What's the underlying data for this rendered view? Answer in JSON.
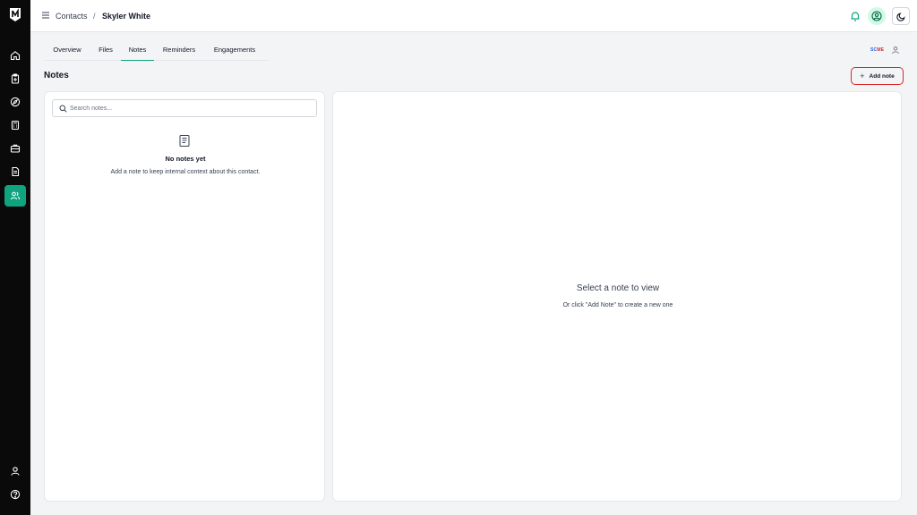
{
  "header": {
    "breadcrumb": [
      "Contacts",
      "/",
      "Skyler White"
    ]
  },
  "tabs": [
    {
      "label": "Overview",
      "active": false
    },
    {
      "label": "Files",
      "active": false
    },
    {
      "label": "Notes",
      "active": true
    },
    {
      "label": "Reminders",
      "active": false
    },
    {
      "label": "Engagements",
      "active": false
    }
  ],
  "brand_badge": {
    "part1": "SC",
    "part2": "ME"
  },
  "notes": {
    "title": "Notes",
    "add_button_label": "Add note",
    "search_placeholder": "Search notes...",
    "empty_title": "No notes yet",
    "empty_description": "Add a note to keep internal context about this contact.",
    "detail_title": "Select a note to view",
    "detail_subtitle": "Or click \"Add Note\" to create a new one"
  },
  "sidebar": {
    "items": [
      {
        "icon": "home-icon"
      },
      {
        "icon": "clipboard-icon"
      },
      {
        "icon": "compass-icon"
      },
      {
        "icon": "calculator-icon"
      },
      {
        "icon": "briefcase-icon"
      },
      {
        "icon": "document-icon"
      },
      {
        "icon": "users-icon",
        "active": true
      }
    ],
    "bottom": [
      {
        "icon": "user-icon"
      },
      {
        "icon": "help-icon"
      }
    ]
  },
  "colors": {
    "accent": "#10a37f",
    "highlight_border": "#dc2626",
    "sidebar_bg": "#0a0a0a"
  }
}
